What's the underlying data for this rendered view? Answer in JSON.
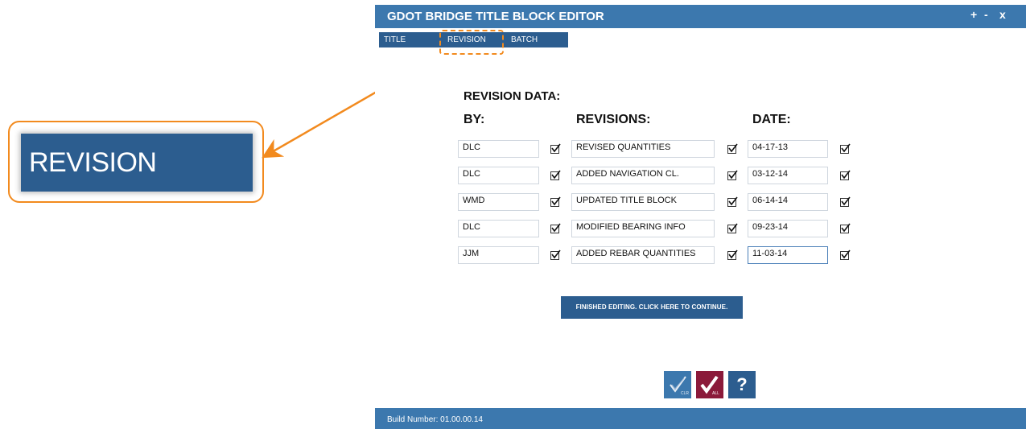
{
  "callout": {
    "label": "REVISION"
  },
  "window": {
    "title": "GDOT BRIDGE TITLE BLOCK EDITOR",
    "controls": {
      "maximize": "+",
      "minimize": "-",
      "close": "x"
    }
  },
  "tabs": [
    {
      "label": "TITLE"
    },
    {
      "label": "REVISION"
    },
    {
      "label": "BATCH"
    }
  ],
  "section_title": "REVISION DATA:",
  "columns": {
    "by": "BY:",
    "revisions": "REVISIONS:",
    "date": "DATE:"
  },
  "rows": [
    {
      "by": "DLC",
      "revision": "REVISED QUANTITIES",
      "date": "04-17-13"
    },
    {
      "by": "DLC",
      "revision": "ADDED NAVIGATION CL.",
      "date": "03-12-14"
    },
    {
      "by": "WMD",
      "revision": "UPDATED TITLE BLOCK",
      "date": "06-14-14"
    },
    {
      "by": "DLC",
      "revision": "MODIFIED BEARING INFO",
      "date": "09-23-14"
    },
    {
      "by": "JJM",
      "revision": "ADDED REBAR QUANTITIES",
      "date": "11-03-14"
    }
  ],
  "continue_button": "FINISHED EDITING. CLICK HERE TO CONTINUE.",
  "toolbar": {
    "clear_icon": "check-clear-icon",
    "all_icon": "check-all-icon",
    "help_label": "?"
  },
  "colors": {
    "accent": "#3c78ae",
    "dark_blue": "#2c5d8f",
    "maroon": "#8b1a3a",
    "orange": "#f28a1e"
  },
  "status": {
    "build": "Build Number: 01.00.00.14"
  }
}
